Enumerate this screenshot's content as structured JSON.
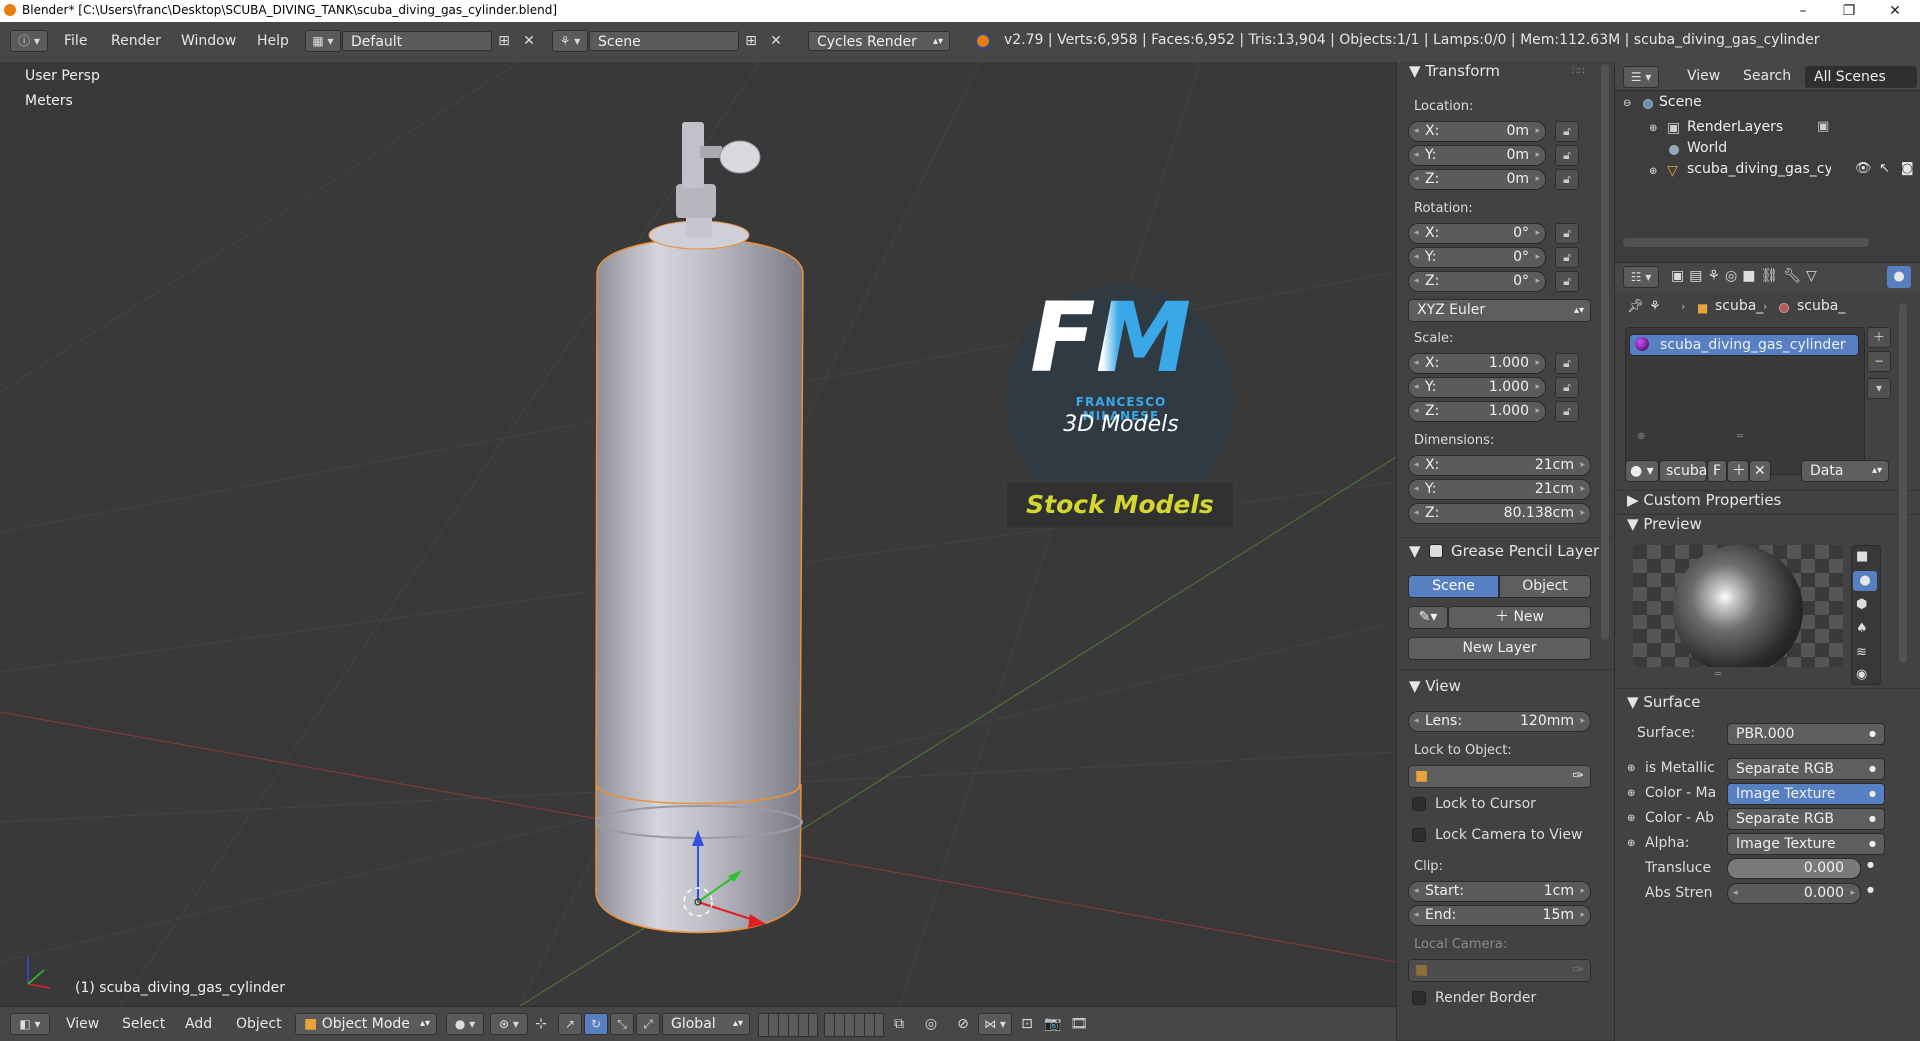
{
  "window": {
    "title": "Blender* [C:\\Users\\franc\\Desktop\\SCUBA_DIVING_TANK\\scuba_diving_gas_cylinder.blend]",
    "minimize": "–",
    "maximize": "❐",
    "close": "✕"
  },
  "topbar": {
    "menus": [
      "File",
      "Render",
      "Window",
      "Help"
    ],
    "screen_layout": "Default",
    "scene": "Scene",
    "render_engine": "Cycles Render",
    "stats": "v2.79 | Verts:6,958 | Faces:6,952 | Tris:13,904 | Objects:1/1 | Lamps:0/0 | Mem:112.63M | scuba_diving_gas_cylinder"
  },
  "viewport": {
    "view_name": "User Persp",
    "units": "Meters",
    "object_label": "(1) scuba_diving_gas_cylinder",
    "watermark": {
      "initials": "FM",
      "name": "FRANCESCO MILANESE",
      "subtitle": "3D Models",
      "banner": "Stock Models"
    }
  },
  "bottombar": {
    "menus": [
      "View",
      "Select",
      "Add",
      "Object"
    ],
    "mode": "Object Mode",
    "orientation": "Global"
  },
  "npanel": {
    "transform": {
      "header": "Transform",
      "location_label": "Location:",
      "location": [
        {
          "axis": "X:",
          "value": "0m"
        },
        {
          "axis": "Y:",
          "value": "0m"
        },
        {
          "axis": "Z:",
          "value": "0m"
        }
      ],
      "rotation_label": "Rotation:",
      "rotation": [
        {
          "axis": "X:",
          "value": "0°"
        },
        {
          "axis": "Y:",
          "value": "0°"
        },
        {
          "axis": "Z:",
          "value": "0°"
        }
      ],
      "rotation_mode": "XYZ Euler",
      "scale_label": "Scale:",
      "scale": [
        {
          "axis": "X:",
          "value": "1.000"
        },
        {
          "axis": "Y:",
          "value": "1.000"
        },
        {
          "axis": "Z:",
          "value": "1.000"
        }
      ],
      "dimensions_label": "Dimensions:",
      "dimensions": [
        {
          "axis": "X:",
          "value": "21cm"
        },
        {
          "axis": "Y:",
          "value": "21cm"
        },
        {
          "axis": "Z:",
          "value": "80.138cm"
        }
      ]
    },
    "grease_pencil": {
      "header": "Grease Pencil Layer",
      "scene_tab": "Scene",
      "object_tab": "Object",
      "new_label": "New",
      "new_layer": "New Layer"
    },
    "view": {
      "header": "View",
      "lens_label": "Lens:",
      "lens_value": "120mm",
      "lock_to_object": "Lock to Object:",
      "lock_to_cursor": "Lock to Cursor",
      "lock_camera": "Lock Camera to View",
      "clip_label": "Clip:",
      "clip_start_label": "Start:",
      "clip_start": "1cm",
      "clip_end_label": "End:",
      "clip_end": "15m",
      "local_camera": "Local Camera:",
      "render_border": "Render Border"
    }
  },
  "outliner": {
    "view_menu": "View",
    "search_menu": "Search",
    "filter": "All Scenes",
    "items": [
      "Scene",
      "RenderLayers",
      "World",
      "scuba_diving_gas_cylir"
    ]
  },
  "properties": {
    "breadcrumb": [
      "scuba_",
      "scuba_"
    ],
    "material_slot": "scuba_diving_gas_cylinder",
    "datablock_name": "scuba",
    "fake_user": "F",
    "link_mode": "Data",
    "custom_properties": "Custom Properties",
    "preview": "Preview",
    "surface_header": "Surface",
    "surface_label": "Surface:",
    "surface_value": "PBR.000",
    "inputs": [
      {
        "label": "is Metallic",
        "value": "Separate RGB",
        "highlight": false
      },
      {
        "label": "Color - Ma",
        "value": "Image Texture",
        "highlight": true
      },
      {
        "label": "Color - Ab",
        "value": "Separate RGB",
        "highlight": false
      },
      {
        "label": "Alpha:",
        "value": "Image Texture",
        "highlight": false
      }
    ],
    "sliders": [
      {
        "label": "Transluce",
        "value": "0.000"
      },
      {
        "label": "Abs Stren",
        "value": "0.000"
      }
    ]
  }
}
